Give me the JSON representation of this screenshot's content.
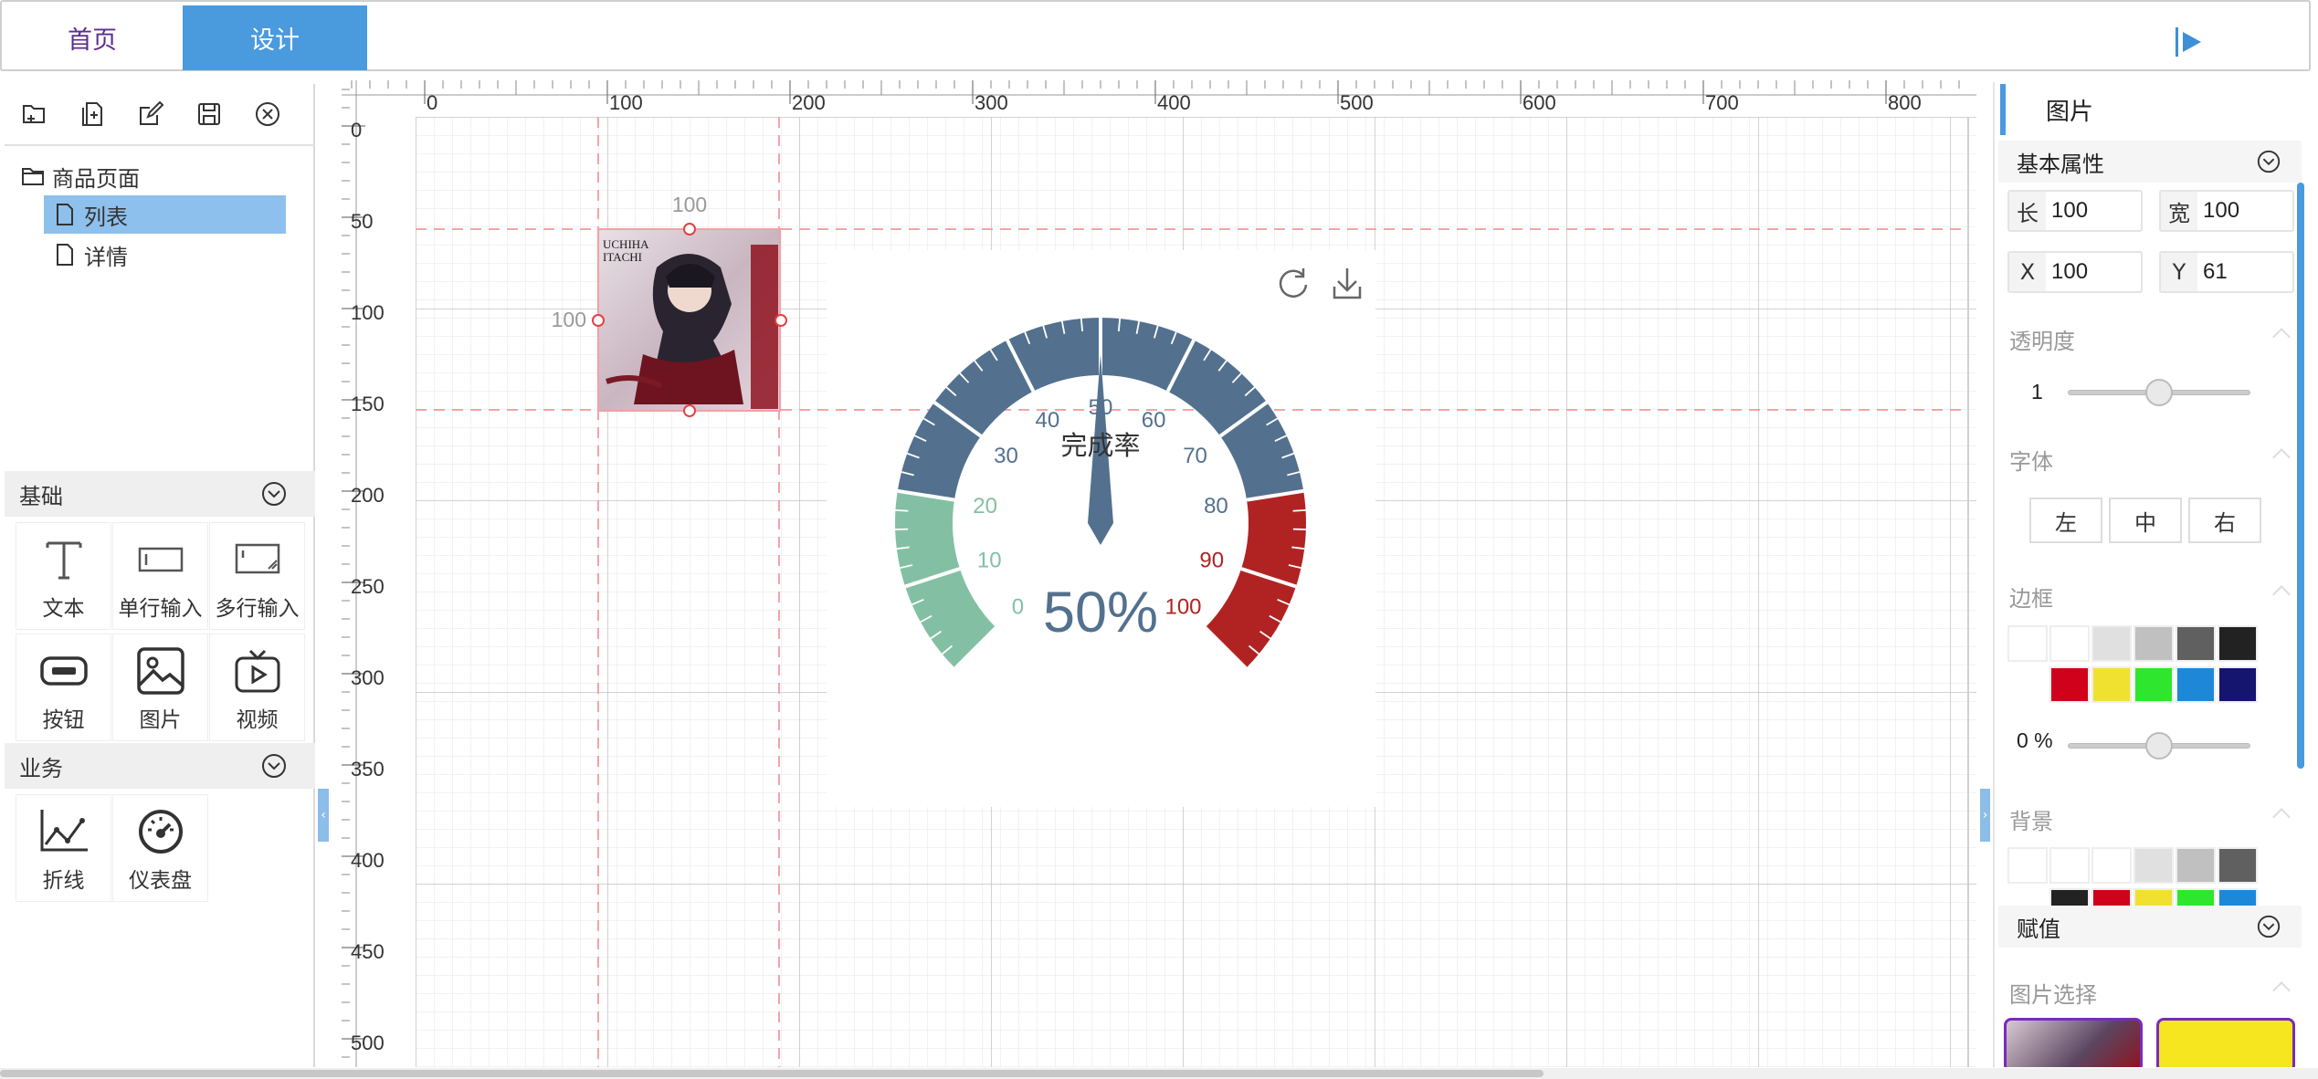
{
  "tabs": {
    "home": "首页",
    "design": "设计"
  },
  "tree": {
    "root": "商品页面",
    "pages": [
      "列表",
      "详情"
    ]
  },
  "palette": {
    "basic": {
      "title": "基础",
      "items": [
        {
          "label": "文本",
          "icon": "text-icon"
        },
        {
          "label": "单行输入",
          "icon": "single-line-input-icon"
        },
        {
          "label": "多行输入",
          "icon": "multi-line-input-icon"
        },
        {
          "label": "按钮",
          "icon": "button-icon"
        },
        {
          "label": "图片",
          "icon": "image-icon"
        },
        {
          "label": "视频",
          "icon": "video-icon"
        }
      ]
    },
    "business": {
      "title": "业务",
      "items": [
        {
          "label": "折线",
          "icon": "line-chart-icon"
        },
        {
          "label": "仪表盘",
          "icon": "gauge-icon"
        }
      ]
    }
  },
  "ruler": {
    "x_ticks": [
      0,
      100,
      200,
      300,
      400,
      500,
      600,
      700,
      800
    ],
    "y_ticks": [
      0,
      50,
      100,
      150,
      200,
      250,
      300,
      350,
      400,
      450,
      500
    ]
  },
  "selection": {
    "width_label": "100",
    "height_label": "100"
  },
  "gauge": {
    "title": "完成率",
    "value": 50,
    "detail": "50%",
    "min": 0,
    "max": 100,
    "tick_labels": [
      "0",
      "10",
      "20",
      "30",
      "40",
      "50",
      "60",
      "70",
      "80",
      "90",
      "100"
    ],
    "bands": [
      {
        "to": 0.2,
        "color": "#83c0a3"
      },
      {
        "to": 0.8,
        "color": "#53718e"
      },
      {
        "to": 1.0,
        "color": "#b12323"
      }
    ]
  },
  "props": {
    "title": "图片",
    "basic": {
      "title": "基本属性",
      "length": {
        "label": "长",
        "value": "100"
      },
      "width": {
        "label": "宽",
        "value": "100"
      },
      "x": {
        "label": "X",
        "value": "100"
      },
      "y": {
        "label": "Y",
        "value": "61"
      }
    },
    "opacity": {
      "title": "透明度",
      "value": "1",
      "position": 0.5
    },
    "font": {
      "title": "字体",
      "left": "左",
      "center": "中",
      "right": "右"
    },
    "border": {
      "title": "边框",
      "percent": "0 %",
      "position": 0.5,
      "colors_row1": [
        "#ffffff",
        "#ffffff",
        "#e0e0e0",
        "#c0c0c0",
        "#606060",
        "#222222"
      ],
      "colors_row2": [
        "#d0021b",
        "#f0e130",
        "#2ee62e",
        "#1e88d8",
        "#15146e"
      ]
    },
    "background": {
      "title": "背景",
      "colors_row1": [
        "#ffffff",
        "#ffffff",
        "#ffffff",
        "#e0e0e0",
        "#c0c0c0",
        "#606060"
      ],
      "colors_row2": [
        "#222222",
        "#d0021b",
        "#f0e130",
        "#2ee62e",
        "#1e88d8"
      ]
    },
    "assign": {
      "title": "赋值"
    },
    "image_select": {
      "title": "图片选择"
    }
  }
}
